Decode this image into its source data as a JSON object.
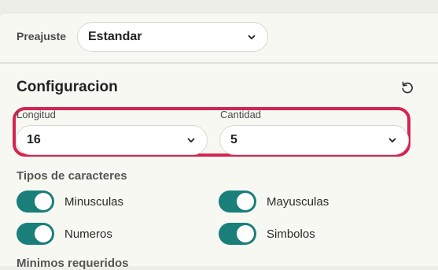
{
  "preset": {
    "label": "Preajuste",
    "selected": "Estandar"
  },
  "config": {
    "title": "Configuracion",
    "reset_icon": "reset-icon",
    "length": {
      "label": "Longitud",
      "value": "16"
    },
    "quantity": {
      "label": "Cantidad",
      "value": "5"
    }
  },
  "char_types": {
    "title": "Tipos de caracteres",
    "options": [
      {
        "label": "Minusculas",
        "enabled": true
      },
      {
        "label": "Mayusculas",
        "enabled": true
      },
      {
        "label": "Numeros",
        "enabled": true
      },
      {
        "label": "Simbolos",
        "enabled": true
      }
    ]
  },
  "minimums": {
    "title": "Minimos requeridos"
  },
  "colors": {
    "accent": "#1a7f7a",
    "highlight": "#d42451",
    "background": "#f8f8f3"
  }
}
